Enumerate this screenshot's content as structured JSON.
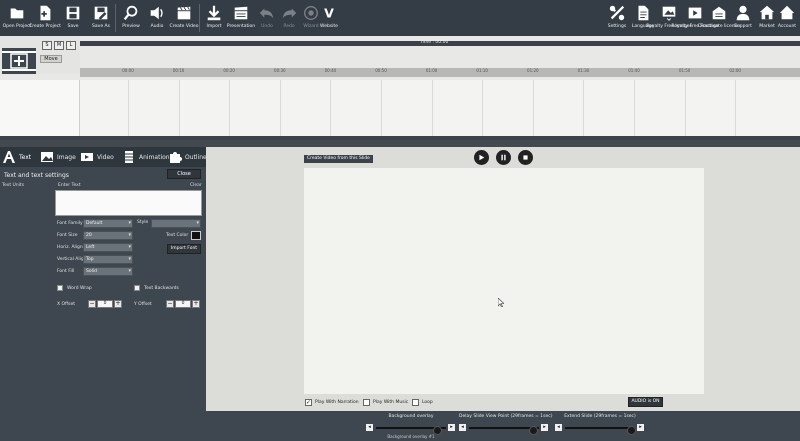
{
  "toolbar": {
    "items": [
      {
        "label": "Open Project",
        "icon": "folder-open-icon"
      },
      {
        "label": "Create Project",
        "icon": "new-project-icon"
      },
      {
        "label": "Save",
        "icon": "save-icon"
      },
      {
        "label": "Save As",
        "icon": "save-as-icon"
      },
      {
        "label": "Preview",
        "icon": "magnifier-icon"
      },
      {
        "label": "Audio",
        "icon": "speaker-icon"
      },
      {
        "label": "Create Video",
        "icon": "clapper-icon"
      },
      {
        "label": "Import",
        "icon": "download-icon"
      },
      {
        "label": "Presentation",
        "icon": "presentation-icon"
      },
      {
        "label": "Undo",
        "icon": "undo-icon"
      },
      {
        "label": "Redo",
        "icon": "redo-icon"
      },
      {
        "label": "Wizard",
        "icon": "wizard-icon"
      },
      {
        "label": "Website",
        "icon": "v-letter-icon",
        "glyph": "V"
      }
    ],
    "right_items": [
      {
        "label": "Settings",
        "icon": "tools-icon"
      },
      {
        "label": "Language",
        "icon": "document-icon"
      },
      {
        "label": "Royalty Free Images",
        "icon": "image-stack-icon"
      },
      {
        "label": "Royalty Free Footage",
        "icon": "film-icon"
      },
      {
        "label": "Deactivate licence",
        "icon": "licence-icon"
      },
      {
        "label": "Support",
        "icon": "support-person-icon"
      },
      {
        "label": "Market",
        "icon": "store-icon"
      },
      {
        "label": "Account",
        "icon": "home-icon"
      }
    ]
  },
  "timeline": {
    "zoom_buttons": [
      "S",
      "M",
      "L"
    ],
    "move_label": "Move",
    "scroll_label": "Time : 00:00",
    "ticks": [
      "00:00",
      "00:10",
      "00:20",
      "00:30",
      "00:40",
      "00:50",
      "01:00",
      "01:10",
      "01:20",
      "01:30",
      "01:40",
      "01:50",
      "02:00"
    ]
  },
  "left_panel": {
    "tabs": [
      {
        "label": "Text",
        "icon": "text-a-icon"
      },
      {
        "label": "Image",
        "icon": "image-icon"
      },
      {
        "label": "Video",
        "icon": "video-icon"
      },
      {
        "label": "Animation",
        "icon": "filmstrip-icon"
      },
      {
        "label": "Outline",
        "icon": "puzzle-icon"
      }
    ],
    "title": "Text and text settings",
    "close_label": "Close",
    "text_units_label": "Text Units",
    "enter_text_label": "Enter Text",
    "clear_label": "Clear",
    "font_family_label": "Font Family",
    "font_family_value": "Default",
    "style_label": "Style",
    "style_value": "",
    "font_size_label": "Font Size",
    "font_size_value": "20",
    "horiz_align_label": "Horiz. Align",
    "horiz_align_value": "Left",
    "vertical_align_label": "Vertical Align",
    "vertical_align_value": "Top",
    "font_fill_label": "Font Fill",
    "font_fill_value": "Solid",
    "text_color_label": "Text Color",
    "text_color_value": "#111111",
    "import_font_label": "Import Font",
    "word_wrap_label": "Word Wrap",
    "text_backwards_label": "Text Backwards",
    "x_offset_label": "X Offset",
    "x_offset_value": "0",
    "y_offset_label": "Y Offset",
    "y_offset_value": "0"
  },
  "preview": {
    "badge": "Create Video from this Slide",
    "play_with_narration": "Play With Narration",
    "play_with_music": "Play With Music",
    "loop": "Loop",
    "audio_label": "AUDIO is ON"
  },
  "bottom_bar": {
    "background_overlay_title": "Background overlay",
    "background_overlay_sub": "Background overlay  #1",
    "delay_title": "Delay Slide View Point (29frames = 1sec)",
    "extend_title": "Extend Slide (29frames = 1sec)"
  }
}
